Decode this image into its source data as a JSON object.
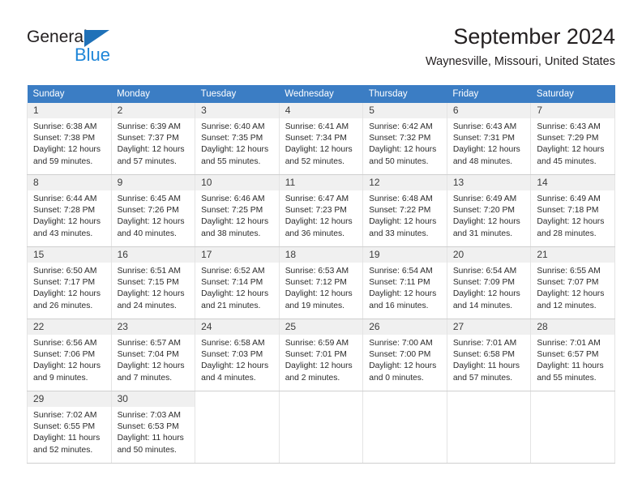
{
  "brand": {
    "name_part1": "General",
    "name_part2": "Blue",
    "triangle_color": "#1f71b8",
    "blue_color": "#1f86d8"
  },
  "header": {
    "title": "September 2024",
    "subtitle": "Waynesville, Missouri, United States"
  },
  "calendar": {
    "header_bg": "#3b7dc4",
    "daynum_bg": "#f0f0f0",
    "weekdays": [
      "Sunday",
      "Monday",
      "Tuesday",
      "Wednesday",
      "Thursday",
      "Friday",
      "Saturday"
    ],
    "labels": {
      "sunrise": "Sunrise:",
      "sunset": "Sunset:",
      "daylight": "Daylight:"
    },
    "weeks": [
      [
        {
          "day": "1",
          "sunrise": "Sunrise: 6:38 AM",
          "sunset": "Sunset: 7:38 PM",
          "daylight1": "Daylight: 12 hours",
          "daylight2": "and 59 minutes."
        },
        {
          "day": "2",
          "sunrise": "Sunrise: 6:39 AM",
          "sunset": "Sunset: 7:37 PM",
          "daylight1": "Daylight: 12 hours",
          "daylight2": "and 57 minutes."
        },
        {
          "day": "3",
          "sunrise": "Sunrise: 6:40 AM",
          "sunset": "Sunset: 7:35 PM",
          "daylight1": "Daylight: 12 hours",
          "daylight2": "and 55 minutes."
        },
        {
          "day": "4",
          "sunrise": "Sunrise: 6:41 AM",
          "sunset": "Sunset: 7:34 PM",
          "daylight1": "Daylight: 12 hours",
          "daylight2": "and 52 minutes."
        },
        {
          "day": "5",
          "sunrise": "Sunrise: 6:42 AM",
          "sunset": "Sunset: 7:32 PM",
          "daylight1": "Daylight: 12 hours",
          "daylight2": "and 50 minutes."
        },
        {
          "day": "6",
          "sunrise": "Sunrise: 6:43 AM",
          "sunset": "Sunset: 7:31 PM",
          "daylight1": "Daylight: 12 hours",
          "daylight2": "and 48 minutes."
        },
        {
          "day": "7",
          "sunrise": "Sunrise: 6:43 AM",
          "sunset": "Sunset: 7:29 PM",
          "daylight1": "Daylight: 12 hours",
          "daylight2": "and 45 minutes."
        }
      ],
      [
        {
          "day": "8",
          "sunrise": "Sunrise: 6:44 AM",
          "sunset": "Sunset: 7:28 PM",
          "daylight1": "Daylight: 12 hours",
          "daylight2": "and 43 minutes."
        },
        {
          "day": "9",
          "sunrise": "Sunrise: 6:45 AM",
          "sunset": "Sunset: 7:26 PM",
          "daylight1": "Daylight: 12 hours",
          "daylight2": "and 40 minutes."
        },
        {
          "day": "10",
          "sunrise": "Sunrise: 6:46 AM",
          "sunset": "Sunset: 7:25 PM",
          "daylight1": "Daylight: 12 hours",
          "daylight2": "and 38 minutes."
        },
        {
          "day": "11",
          "sunrise": "Sunrise: 6:47 AM",
          "sunset": "Sunset: 7:23 PM",
          "daylight1": "Daylight: 12 hours",
          "daylight2": "and 36 minutes."
        },
        {
          "day": "12",
          "sunrise": "Sunrise: 6:48 AM",
          "sunset": "Sunset: 7:22 PM",
          "daylight1": "Daylight: 12 hours",
          "daylight2": "and 33 minutes."
        },
        {
          "day": "13",
          "sunrise": "Sunrise: 6:49 AM",
          "sunset": "Sunset: 7:20 PM",
          "daylight1": "Daylight: 12 hours",
          "daylight2": "and 31 minutes."
        },
        {
          "day": "14",
          "sunrise": "Sunrise: 6:49 AM",
          "sunset": "Sunset: 7:18 PM",
          "daylight1": "Daylight: 12 hours",
          "daylight2": "and 28 minutes."
        }
      ],
      [
        {
          "day": "15",
          "sunrise": "Sunrise: 6:50 AM",
          "sunset": "Sunset: 7:17 PM",
          "daylight1": "Daylight: 12 hours",
          "daylight2": "and 26 minutes."
        },
        {
          "day": "16",
          "sunrise": "Sunrise: 6:51 AM",
          "sunset": "Sunset: 7:15 PM",
          "daylight1": "Daylight: 12 hours",
          "daylight2": "and 24 minutes."
        },
        {
          "day": "17",
          "sunrise": "Sunrise: 6:52 AM",
          "sunset": "Sunset: 7:14 PM",
          "daylight1": "Daylight: 12 hours",
          "daylight2": "and 21 minutes."
        },
        {
          "day": "18",
          "sunrise": "Sunrise: 6:53 AM",
          "sunset": "Sunset: 7:12 PM",
          "daylight1": "Daylight: 12 hours",
          "daylight2": "and 19 minutes."
        },
        {
          "day": "19",
          "sunrise": "Sunrise: 6:54 AM",
          "sunset": "Sunset: 7:11 PM",
          "daylight1": "Daylight: 12 hours",
          "daylight2": "and 16 minutes."
        },
        {
          "day": "20",
          "sunrise": "Sunrise: 6:54 AM",
          "sunset": "Sunset: 7:09 PM",
          "daylight1": "Daylight: 12 hours",
          "daylight2": "and 14 minutes."
        },
        {
          "day": "21",
          "sunrise": "Sunrise: 6:55 AM",
          "sunset": "Sunset: 7:07 PM",
          "daylight1": "Daylight: 12 hours",
          "daylight2": "and 12 minutes."
        }
      ],
      [
        {
          "day": "22",
          "sunrise": "Sunrise: 6:56 AM",
          "sunset": "Sunset: 7:06 PM",
          "daylight1": "Daylight: 12 hours",
          "daylight2": "and 9 minutes."
        },
        {
          "day": "23",
          "sunrise": "Sunrise: 6:57 AM",
          "sunset": "Sunset: 7:04 PM",
          "daylight1": "Daylight: 12 hours",
          "daylight2": "and 7 minutes."
        },
        {
          "day": "24",
          "sunrise": "Sunrise: 6:58 AM",
          "sunset": "Sunset: 7:03 PM",
          "daylight1": "Daylight: 12 hours",
          "daylight2": "and 4 minutes."
        },
        {
          "day": "25",
          "sunrise": "Sunrise: 6:59 AM",
          "sunset": "Sunset: 7:01 PM",
          "daylight1": "Daylight: 12 hours",
          "daylight2": "and 2 minutes."
        },
        {
          "day": "26",
          "sunrise": "Sunrise: 7:00 AM",
          "sunset": "Sunset: 7:00 PM",
          "daylight1": "Daylight: 12 hours",
          "daylight2": "and 0 minutes."
        },
        {
          "day": "27",
          "sunrise": "Sunrise: 7:01 AM",
          "sunset": "Sunset: 6:58 PM",
          "daylight1": "Daylight: 11 hours",
          "daylight2": "and 57 minutes."
        },
        {
          "day": "28",
          "sunrise": "Sunrise: 7:01 AM",
          "sunset": "Sunset: 6:57 PM",
          "daylight1": "Daylight: 11 hours",
          "daylight2": "and 55 minutes."
        }
      ],
      [
        {
          "day": "29",
          "sunrise": "Sunrise: 7:02 AM",
          "sunset": "Sunset: 6:55 PM",
          "daylight1": "Daylight: 11 hours",
          "daylight2": "and 52 minutes."
        },
        {
          "day": "30",
          "sunrise": "Sunrise: 7:03 AM",
          "sunset": "Sunset: 6:53 PM",
          "daylight1": "Daylight: 11 hours",
          "daylight2": "and 50 minutes."
        },
        {
          "day": "",
          "sunrise": "",
          "sunset": "",
          "daylight1": "",
          "daylight2": ""
        },
        {
          "day": "",
          "sunrise": "",
          "sunset": "",
          "daylight1": "",
          "daylight2": ""
        },
        {
          "day": "",
          "sunrise": "",
          "sunset": "",
          "daylight1": "",
          "daylight2": ""
        },
        {
          "day": "",
          "sunrise": "",
          "sunset": "",
          "daylight1": "",
          "daylight2": ""
        },
        {
          "day": "",
          "sunrise": "",
          "sunset": "",
          "daylight1": "",
          "daylight2": ""
        }
      ]
    ]
  }
}
